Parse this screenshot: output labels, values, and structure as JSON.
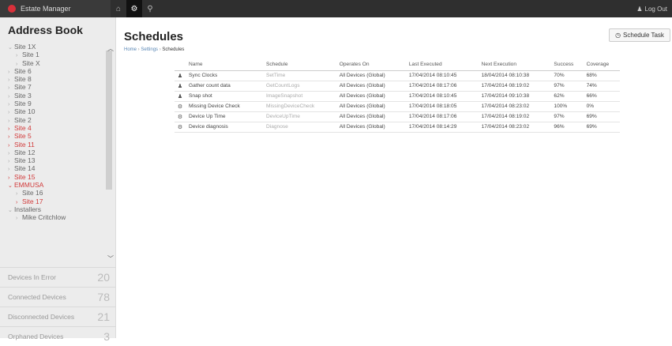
{
  "app": {
    "name": "Estate Manager",
    "logout_label": "Log Out"
  },
  "nav": {
    "home_icon": "home-icon",
    "settings_icon": "gear-icon",
    "search_icon": "search-icon"
  },
  "sidebar": {
    "title": "Address Book",
    "tree": [
      {
        "label": "Site 1X",
        "chev": "⌄",
        "indent": 0
      },
      {
        "label": "Site 1",
        "chev": "›",
        "indent": 1
      },
      {
        "label": "Site X",
        "chev": "›",
        "indent": 1
      },
      {
        "label": "Site 6",
        "chev": "›",
        "indent": 0
      },
      {
        "label": "Site 8",
        "chev": "›",
        "indent": 0
      },
      {
        "label": "Site 7",
        "chev": "›",
        "indent": 0
      },
      {
        "label": "Site 3",
        "chev": "›",
        "indent": 0
      },
      {
        "label": "Site 9",
        "chev": "›",
        "indent": 0
      },
      {
        "label": "Site 10",
        "chev": "›",
        "indent": 0
      },
      {
        "label": "Site 2",
        "chev": "›",
        "indent": 0
      },
      {
        "label": "Site 4",
        "chev": "›",
        "indent": 0,
        "red": true
      },
      {
        "label": "Site 5",
        "chev": "›",
        "indent": 0,
        "red": true
      },
      {
        "label": "Site 11",
        "chev": "›",
        "indent": 0,
        "red": true
      },
      {
        "label": "Site 12",
        "chev": "›",
        "indent": 0
      },
      {
        "label": "Site 13",
        "chev": "›",
        "indent": 0
      },
      {
        "label": "Site 14",
        "chev": "›",
        "indent": 0
      },
      {
        "label": "Site 15",
        "chev": "›",
        "indent": 0,
        "red": true
      },
      {
        "label": "EMMUSA",
        "chev": "⌄",
        "indent": 0,
        "red": true
      },
      {
        "label": "Site 16",
        "chev": "›",
        "indent": 1
      },
      {
        "label": "Site 17",
        "chev": "›",
        "indent": 1,
        "red": true
      },
      {
        "label": "Installers",
        "chev": "⌄",
        "indent": 0
      },
      {
        "label": "Mike Critchlow",
        "chev": "›",
        "indent": 1
      }
    ],
    "stats": [
      {
        "label": "Devices In Error",
        "count": "20"
      },
      {
        "label": "Connected Devices",
        "count": "78"
      },
      {
        "label": "Disconnected Devices",
        "count": "21"
      },
      {
        "label": "Orphaned Devices",
        "count": "3"
      }
    ]
  },
  "main": {
    "title": "Schedules",
    "breadcrumb": {
      "home": "Home",
      "settings": "Settings",
      "current": "Schedules",
      "sep": " › "
    },
    "schedule_button": "Schedule Task",
    "table": {
      "headers": [
        "Name",
        "Schedule",
        "Operates On",
        "Last Executed",
        "Next Execution",
        "Success",
        "Coverage"
      ],
      "rows": [
        {
          "icon": "person-icon",
          "glyph": "♟",
          "name": "Sync Clocks",
          "schedule": "SetTime",
          "operates": "All Devices (Global)",
          "last": "17/04/2014 08:10:45",
          "next": "18/04/2014 08:10:38",
          "success": "70%",
          "coverage": "68%"
        },
        {
          "icon": "person-icon",
          "glyph": "♟",
          "name": "Gather count data",
          "schedule": "GetCountLogs",
          "operates": "All Devices (Global)",
          "last": "17/04/2014 08:17:06",
          "next": "17/04/2014 08:19:02",
          "success": "97%",
          "coverage": "74%"
        },
        {
          "icon": "person-icon",
          "glyph": "♟",
          "name": "Snap shot",
          "schedule": "ImageSnapshot",
          "operates": "All Devices (Global)",
          "last": "17/04/2014 08:10:45",
          "next": "17/04/2014 09:10:38",
          "success": "62%",
          "coverage": "66%"
        },
        {
          "icon": "gear-icon",
          "glyph": "⚙",
          "name": "Missing Device Check",
          "schedule": "MissingDeviceCheck",
          "operates": "All Devices (Global)",
          "last": "17/04/2014 08:18:05",
          "next": "17/04/2014 08:23:02",
          "success": "100%",
          "coverage": "0%"
        },
        {
          "icon": "gear-icon",
          "glyph": "⚙",
          "name": "Device Up Time",
          "schedule": "DeviceUpTime",
          "operates": "All Devices (Global)",
          "last": "17/04/2014 08:17:06",
          "next": "17/04/2014 08:19:02",
          "success": "97%",
          "coverage": "69%"
        },
        {
          "icon": "gear-icon",
          "glyph": "⚙",
          "name": "Device diagnosis",
          "schedule": "Diagnose",
          "operates": "All Devices (Global)",
          "last": "17/04/2014 08:14:29",
          "next": "17/04/2014 08:23:02",
          "success": "96%",
          "coverage": "69%"
        }
      ]
    }
  }
}
